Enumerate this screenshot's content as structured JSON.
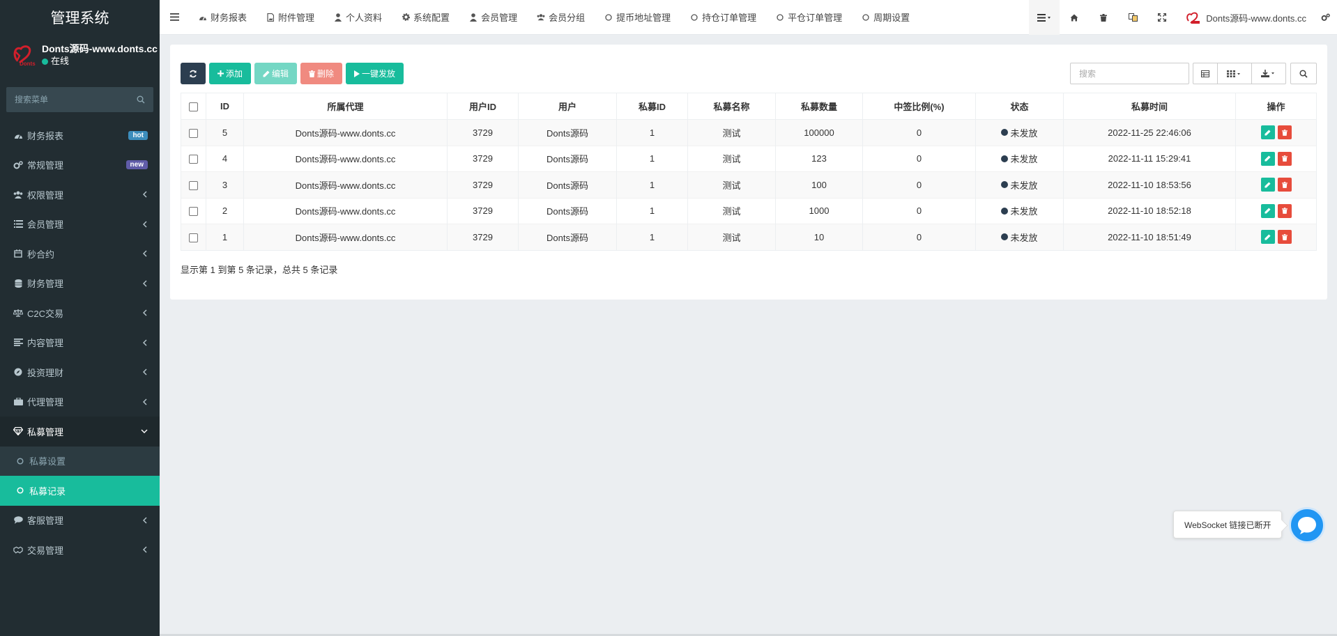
{
  "sidebar": {
    "brand": "管理系统",
    "user": {
      "name": "Donts源码-www.donts.cc",
      "status": "在线",
      "logo_text": "Donts"
    },
    "search_placeholder": "搜索菜单",
    "items": [
      {
        "label": "财务报表",
        "icon": "dashboard-icon",
        "badge": "hot"
      },
      {
        "label": "常规管理",
        "icon": "cogs-icon",
        "badge": "new"
      },
      {
        "label": "权限管理",
        "icon": "users-icon"
      },
      {
        "label": "会员管理",
        "icon": "list-icon"
      },
      {
        "label": "秒合约",
        "icon": "calendar-icon"
      },
      {
        "label": "财务管理",
        "icon": "database-icon"
      },
      {
        "label": "C2C交易",
        "icon": "balance-icon"
      },
      {
        "label": "内容管理",
        "icon": "align-left-icon"
      },
      {
        "label": "投资理财",
        "icon": "compass-icon"
      },
      {
        "label": "代理管理",
        "icon": "briefcase-icon"
      },
      {
        "label": "私募管理",
        "icon": "diamond-icon"
      },
      {
        "label": "客服管理",
        "icon": "comment-icon"
      },
      {
        "label": "交易管理",
        "icon": "handshake-icon"
      }
    ],
    "sub_items": [
      {
        "label": "私募设置"
      },
      {
        "label": "私募记录"
      }
    ]
  },
  "topbar": {
    "tabs": [
      {
        "label": "财务报表",
        "icon": "dashboard-icon"
      },
      {
        "label": "附件管理",
        "icon": "file-image-icon"
      },
      {
        "label": "个人资料",
        "icon": "user-icon"
      },
      {
        "label": "系统配置",
        "icon": "cog-icon"
      },
      {
        "label": "会员管理",
        "icon": "user-icon"
      },
      {
        "label": "会员分组",
        "icon": "users-icon"
      },
      {
        "label": "提币地址管理",
        "icon": "circle-icon"
      },
      {
        "label": "持仓订单管理",
        "icon": "circle-icon"
      },
      {
        "label": "平仓订单管理",
        "icon": "circle-icon"
      },
      {
        "label": "周期设置",
        "icon": "circle-icon"
      }
    ],
    "user_name": "Donts源码-www.donts.cc"
  },
  "toolbar": {
    "add": "添加",
    "edit": "编辑",
    "delete": "删除",
    "dispatch": "一键发放",
    "search_placeholder": "搜索"
  },
  "table": {
    "headers": [
      "ID",
      "所属代理",
      "用户ID",
      "用户",
      "私募ID",
      "私募名称",
      "私募数量",
      "中签比例(%)",
      "状态",
      "私募时间",
      "操作"
    ],
    "rows": [
      {
        "id": "5",
        "agent": "Donts源码-www.donts.cc",
        "uid": "3729",
        "user": "Donts源码",
        "pid": "1",
        "pname": "测试",
        "qty": "100000",
        "ratio": "0",
        "status": "未发放",
        "time": "2022-11-25 22:46:06"
      },
      {
        "id": "4",
        "agent": "Donts源码-www.donts.cc",
        "uid": "3729",
        "user": "Donts源码",
        "pid": "1",
        "pname": "测试",
        "qty": "123",
        "ratio": "0",
        "status": "未发放",
        "time": "2022-11-11 15:29:41"
      },
      {
        "id": "3",
        "agent": "Donts源码-www.donts.cc",
        "uid": "3729",
        "user": "Donts源码",
        "pid": "1",
        "pname": "测试",
        "qty": "100",
        "ratio": "0",
        "status": "未发放",
        "time": "2022-11-10 18:53:56"
      },
      {
        "id": "2",
        "agent": "Donts源码-www.donts.cc",
        "uid": "3729",
        "user": "Donts源码",
        "pid": "1",
        "pname": "测试",
        "qty": "1000",
        "ratio": "0",
        "status": "未发放",
        "time": "2022-11-10 18:52:18"
      },
      {
        "id": "1",
        "agent": "Donts源码-www.donts.cc",
        "uid": "3729",
        "user": "Donts源码",
        "pid": "1",
        "pname": "测试",
        "qty": "10",
        "ratio": "0",
        "status": "未发放",
        "time": "2022-11-10 18:51:49"
      }
    ]
  },
  "pagination": {
    "info": "显示第 1 到第 5 条记录，总共 5 条记录"
  },
  "websocket": {
    "message": "WebSocket 链接已断开"
  },
  "colors": {
    "sidebar_bg": "#222d32",
    "accent": "#18bc9c",
    "danger": "#e74c3c",
    "dark": "#2c3e50",
    "ws_blue": "#2196f3"
  }
}
